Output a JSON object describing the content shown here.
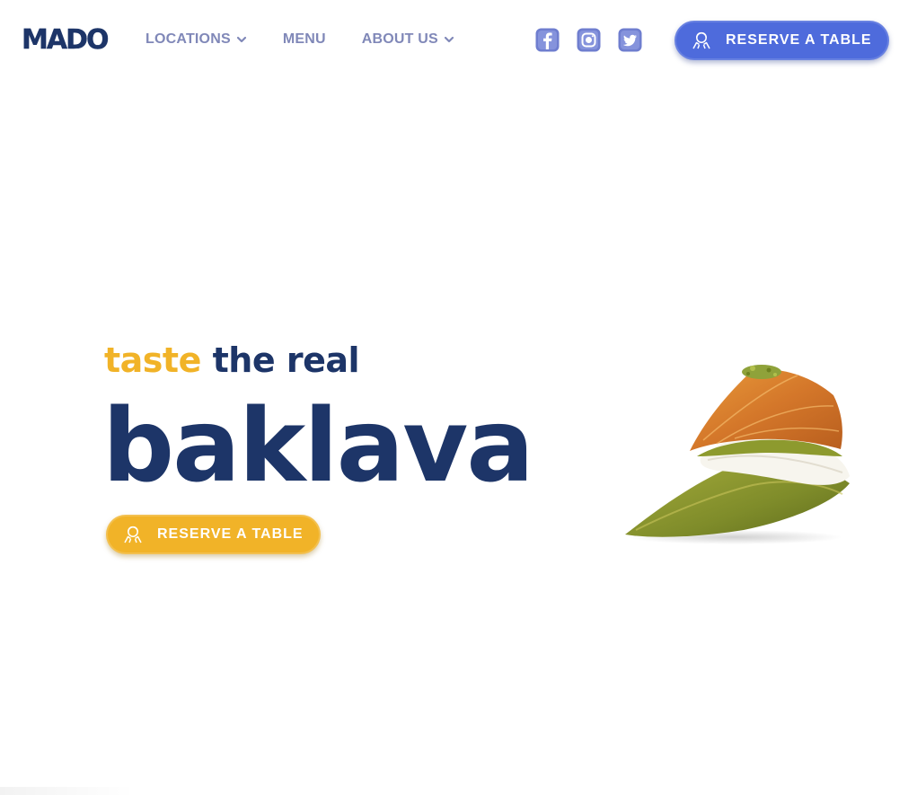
{
  "brand": {
    "logo_text": "MADO",
    "primary_color": "#1d3568",
    "accent_color": "#f1b328",
    "button_blue": "#4e6bdc",
    "nav_color": "#8088b8"
  },
  "nav": {
    "items": [
      {
        "label": "LOCATIONS",
        "has_dropdown": true
      },
      {
        "label": "MENU",
        "has_dropdown": false
      },
      {
        "label": "ABOUT US",
        "has_dropdown": true
      }
    ]
  },
  "socials": [
    {
      "icon": "facebook-icon"
    },
    {
      "icon": "instagram-icon"
    },
    {
      "icon": "twitter-icon"
    }
  ],
  "header_cta": {
    "label": "RESERVE A TABLE",
    "icon": "reserve-table-icon"
  },
  "hero": {
    "subtitle_accent": "taste",
    "subtitle_rest": "the real",
    "title": "baklava",
    "cta_label": "RESERVE A TABLE",
    "cta_icon": "reserve-table-icon",
    "image": "baklava-image"
  }
}
